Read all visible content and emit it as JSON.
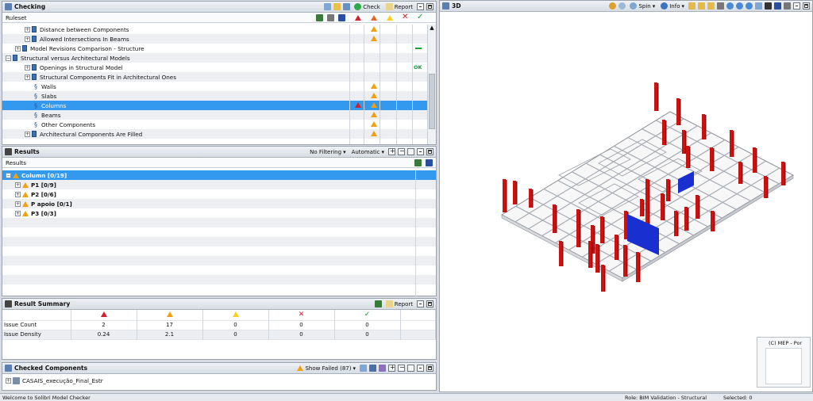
{
  "checking": {
    "title": "Checking",
    "check_label": "Check",
    "report_label": "Report",
    "ruleset_label": "Ruleset",
    "rows": [
      {
        "label": "Distance between Components",
        "indent": 2,
        "warn": true
      },
      {
        "label": "Allowed Intersections In Beams",
        "indent": 2,
        "warn": true
      },
      {
        "label": "Model Revisions Comparison - Structure",
        "indent": 1,
        "status": "dash"
      },
      {
        "label": "Structural versus Architectural Models",
        "indent": 0
      },
      {
        "label": "Openings in Structural Model",
        "indent": 2,
        "status": "OK"
      },
      {
        "label": "Structural Components Fit in Architectural Ones",
        "indent": 2
      },
      {
        "label": "Walls",
        "indent": 3,
        "warn": true
      },
      {
        "label": "Slabs",
        "indent": 3,
        "warn": true
      },
      {
        "label": "Columns",
        "indent": 3,
        "warn": true,
        "crit": true,
        "selected": true
      },
      {
        "label": "Beams",
        "indent": 3,
        "warn": true
      },
      {
        "label": "Other Components",
        "indent": 3,
        "warn": true
      },
      {
        "label": "Architectural Components Are Filled",
        "indent": 2,
        "warn": true
      }
    ]
  },
  "results": {
    "title": "Results",
    "filter_label": "No Filtering",
    "mode_label": "Automatic",
    "header": "Results",
    "rows": [
      {
        "label": "Column [0/19]",
        "selected": true
      },
      {
        "label": "P1 [0/9]"
      },
      {
        "label": "P2 [0/6]"
      },
      {
        "label": "P apoio [0/1]"
      },
      {
        "label": "P3 [0/3]"
      }
    ]
  },
  "summary": {
    "title": "Result Summary",
    "report_label": "Report",
    "rows": [
      {
        "label": "Issue Count",
        "values": [
          "2",
          "17",
          "0",
          "0",
          "0"
        ]
      },
      {
        "label": "Issue Density",
        "values": [
          "0.24",
          "2.1",
          "0",
          "0",
          "0"
        ]
      }
    ]
  },
  "checked": {
    "title": "Checked Components",
    "show_failed_label": "Show Failed (87)",
    "item": "CASAIS_execução_Final_Estr"
  },
  "view3d": {
    "title": "3D",
    "spin_label": "Spin",
    "info_label": "Info",
    "minimap_label": "(C) MEP - Por"
  },
  "status": {
    "left": "Welcome to Solibri Model Checker",
    "role": "Role: BIM Validation - Structural",
    "selected": "Selected: 0"
  },
  "colors": {
    "accent": "#3399ee",
    "column_red": "#cc1111",
    "issue_blue": "#1a2fd0"
  }
}
